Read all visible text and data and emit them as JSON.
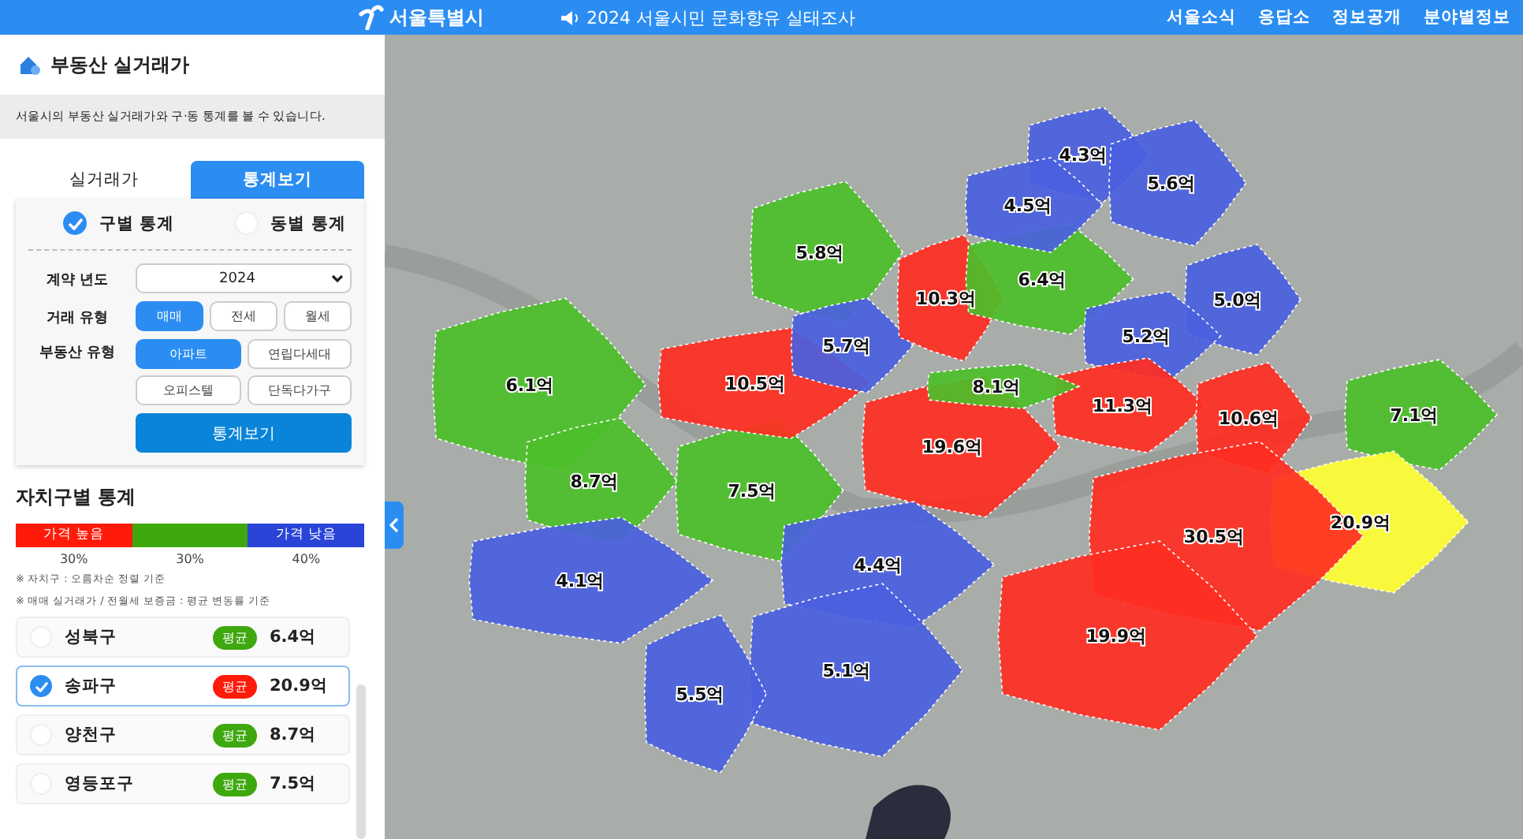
{
  "topbar": {
    "logo": "서울특별시",
    "notice": "2024 서울시민 문화향유 실태조사",
    "links": [
      "서울소식",
      "응답소",
      "정보공개",
      "분야별정보"
    ]
  },
  "panel": {
    "title": "부동산 실거래가",
    "description": "서울시의 부동산 실거래가와 구·동 통계를 볼 수 있습니다.",
    "tabs": [
      {
        "label": "실거래가",
        "selected": false
      },
      {
        "label": "통계보기",
        "selected": true
      }
    ],
    "scope": [
      {
        "label": "구별 통계",
        "selected": true
      },
      {
        "label": "동별 통계",
        "selected": false
      }
    ],
    "year": {
      "label": "계약 년도",
      "value": "2024"
    },
    "deal_type": {
      "label": "거래 유형",
      "options": [
        {
          "label": "매매",
          "selected": true
        },
        {
          "label": "전세",
          "selected": false
        },
        {
          "label": "월세",
          "selected": false
        }
      ]
    },
    "property_type": {
      "label": "부동산 유형",
      "options": [
        {
          "label": "아파트",
          "selected": true
        },
        {
          "label": "연립다세대",
          "selected": false
        },
        {
          "label": "오피스텔",
          "selected": false
        },
        {
          "label": "단독다가구",
          "selected": false
        }
      ]
    },
    "submit": "통계보기"
  },
  "stats": {
    "title": "자치구별 통계",
    "legend": [
      {
        "label": "가격 높음",
        "share": "30%",
        "color": "#ff1a0a"
      },
      {
        "share": "30%",
        "color": "#3ea80e"
      },
      {
        "label": "가격 낮음",
        "share": "40%",
        "color": "#2a44d8"
      }
    ],
    "notes": [
      "※ 자치구 : 오름차순 정렬 기준",
      "※ 매매 실거래가 / 전월세 보증금 : 평균 변동률 기준"
    ],
    "districts": [
      {
        "name": "성북구",
        "badge": "평균",
        "price": "6.4억",
        "color": "#3ea80e",
        "selected": false
      },
      {
        "name": "송파구",
        "badge": "평균",
        "price": "20.9억",
        "color": "#ff1a0a",
        "selected": true
      },
      {
        "name": "양천구",
        "badge": "평균",
        "price": "8.7억",
        "color": "#3ea80e",
        "selected": false
      },
      {
        "name": "영등포구",
        "badge": "평균",
        "price": "7.5억",
        "color": "#3ea80e",
        "selected": false
      }
    ]
  },
  "map": {
    "regions": [
      {
        "price": "6.1억",
        "color": "#4cbf2a"
      },
      {
        "price": "8.7억",
        "color": "#4cbf2a"
      },
      {
        "price": "7.5억",
        "color": "#4cbf2a"
      },
      {
        "price": "5.8억",
        "color": "#4cbf2a"
      },
      {
        "price": "10.5억",
        "color": "#ff2e22"
      },
      {
        "price": "5.7억",
        "color": "#4a5fe0"
      },
      {
        "price": "10.3억",
        "color": "#ff2e22"
      },
      {
        "price": "6.4억",
        "color": "#4cbf2a"
      },
      {
        "price": "4.3억",
        "color": "#4a5fe0"
      },
      {
        "price": "4.5억",
        "color": "#4a5fe0"
      },
      {
        "price": "5.6억",
        "color": "#4a5fe0"
      },
      {
        "price": "5.0억",
        "color": "#4a5fe0"
      },
      {
        "price": "5.2억",
        "color": "#4a5fe0"
      },
      {
        "price": "8.1억",
        "color": "#4cbf2a"
      },
      {
        "price": "11.3억",
        "color": "#ff2e22"
      },
      {
        "price": "10.6억",
        "color": "#ff2e22"
      },
      {
        "price": "7.1억",
        "color": "#4cbf2a"
      },
      {
        "price": "19.6억",
        "color": "#ff2e22"
      },
      {
        "price": "20.9억",
        "color": "#ffff33"
      },
      {
        "price": "30.5억",
        "color": "#ff2e22"
      },
      {
        "price": "4.1억",
        "color": "#4a5fe0"
      },
      {
        "price": "4.4억",
        "color": "#4a5fe0"
      },
      {
        "price": "19.9억",
        "color": "#ff2e22"
      },
      {
        "price": "5.1억",
        "color": "#4a5fe0"
      },
      {
        "price": "5.5억",
        "color": "#4a5fe0"
      }
    ]
  }
}
